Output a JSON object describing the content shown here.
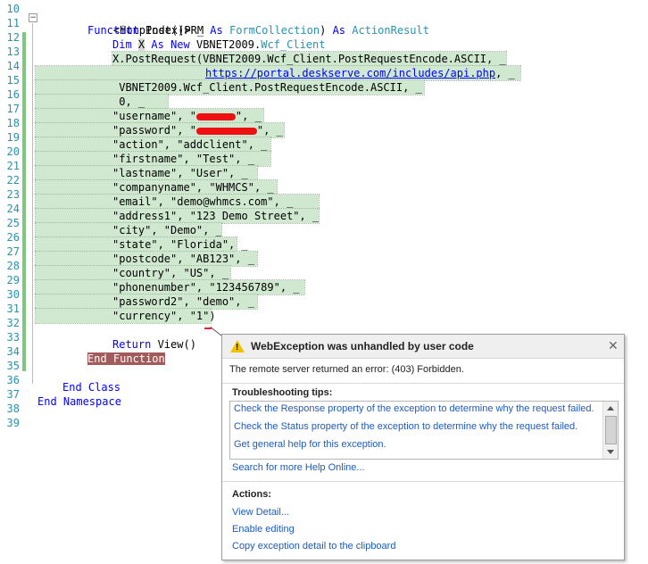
{
  "editor": {
    "line_numbers": [
      "10",
      "11",
      "12",
      "13",
      "14",
      "15",
      "16",
      "17",
      "18",
      "19",
      "20",
      "21",
      "22",
      "23",
      "24",
      "25",
      "26",
      "27",
      "28",
      "29",
      "30",
      "31",
      "32",
      "33",
      "34",
      "35",
      "36",
      "37",
      "38",
      "39"
    ],
    "lines": {
      "l10": "<HttpPost()> _",
      "l11_kw1": "Function",
      "l11_a": " Index(PRM ",
      "l11_kw2": "As",
      "l11_ty1": "FormCollection",
      "l11_b": ") ",
      "l11_kw3": "As",
      "l11_ty2": "ActionResult",
      "l12_kw1": "Dim",
      "l12_x": "X",
      "l12_kw2": "As New",
      "l12_a": " VBNET2009.",
      "l12_ty": "Wcf_Client",
      "l13": "X.PostRequest(VBNET2009.Wcf_Client.PostRequestEncode.ASCII, _",
      "l14_url": "https://portal.deskserve.com/includes/api.php",
      "l14_tail": ", _",
      "l15": " VBNET2009.Wcf_Client.PostRequestEncode.ASCII, _",
      "l16": " 0, _",
      "l17_a": "\"username\", \"",
      "l17_b": "\", _",
      "l18_a": "\"password\", \"",
      "l18_b": "\", _",
      "l19": "\"action\", \"addclient\", _",
      "l20": "\"firstname\", \"Test\", _",
      "l21": "\"lastname\", \"User\", _",
      "l22": "\"companyname\", \"WHMCS\", _",
      "l23": "\"email\", \"demo@whmcs.com\", _",
      "l24": "\"address1\", \"123 Demo Street\", _",
      "l25": "\"city\", \"Demo\", _",
      "l26": "\"state\", \"Florida\", _",
      "l27": "\"postcode\", \"AB123\", _",
      "l28": "\"country\", \"US\", _",
      "l29": "\"phonenumber\", \"123456789\", _",
      "l30": "\"password2\", \"demo\", _",
      "l31": "\"currency\", \"1\")",
      "l33_kw": "Return",
      "l33_a": " View()",
      "l34": "End Function",
      "l36_kw": "End Class",
      "l37_kw": "End Namespace"
    }
  },
  "exception": {
    "title": "WebException was unhandled by user code",
    "message": "The remote server returned an error: (403) Forbidden.",
    "tips_heading": "Troubleshooting tips:",
    "tips": [
      "Check the Response property of the exception to determine why the request failed.",
      "Check the Status property of the exception to determine why the request failed.",
      "Get general help for this exception."
    ],
    "search_link": "Search for more Help Online...",
    "actions_heading": "Actions:",
    "actions": [
      "View Detail...",
      "Enable editing",
      "Copy exception detail to the clipboard"
    ]
  },
  "colors": {
    "selection": "#cfe8cf",
    "keyword": "#0000ff",
    "type": "#2b91af",
    "link": "#1e5bb8",
    "end_function_highlight": "#a35a5a",
    "warning_icon": "#f2c200"
  },
  "icons": {
    "warning": "warning-triangle-icon",
    "close": "close-icon"
  }
}
